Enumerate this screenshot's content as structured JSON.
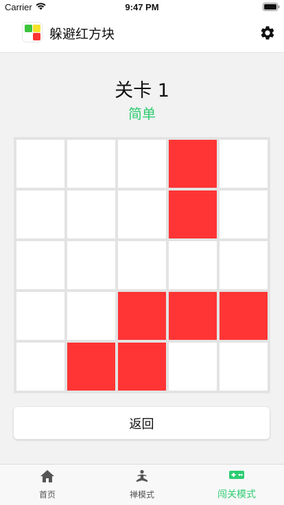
{
  "status_bar": {
    "carrier": "Carrier",
    "time": "9:47 PM"
  },
  "app": {
    "title": "躲避红方块"
  },
  "level": {
    "title": "关卡 1",
    "difficulty": "简单"
  },
  "colors": {
    "red_block": "#ff3535",
    "empty_cell": "#ffffff",
    "grid_border": "#e3e3e3",
    "accent_green": "#2ecc71",
    "logo_green": "#3cc43c",
    "logo_yellow": "#f5e12a",
    "logo_red": "#ff3535"
  },
  "board": {
    "rows": 5,
    "cols": 5,
    "cells": [
      [
        0,
        0,
        0,
        1,
        0
      ],
      [
        0,
        0,
        0,
        1,
        0
      ],
      [
        0,
        0,
        0,
        0,
        0
      ],
      [
        0,
        0,
        1,
        1,
        1
      ],
      [
        0,
        1,
        1,
        0,
        0
      ]
    ]
  },
  "back_button": {
    "label": "返回"
  },
  "tabs": [
    {
      "label": "首页",
      "icon": "home-icon",
      "active": false
    },
    {
      "label": "禅模式",
      "icon": "meditation-icon",
      "active": false
    },
    {
      "label": "闯关模式",
      "icon": "gamepad-icon",
      "active": true
    }
  ]
}
